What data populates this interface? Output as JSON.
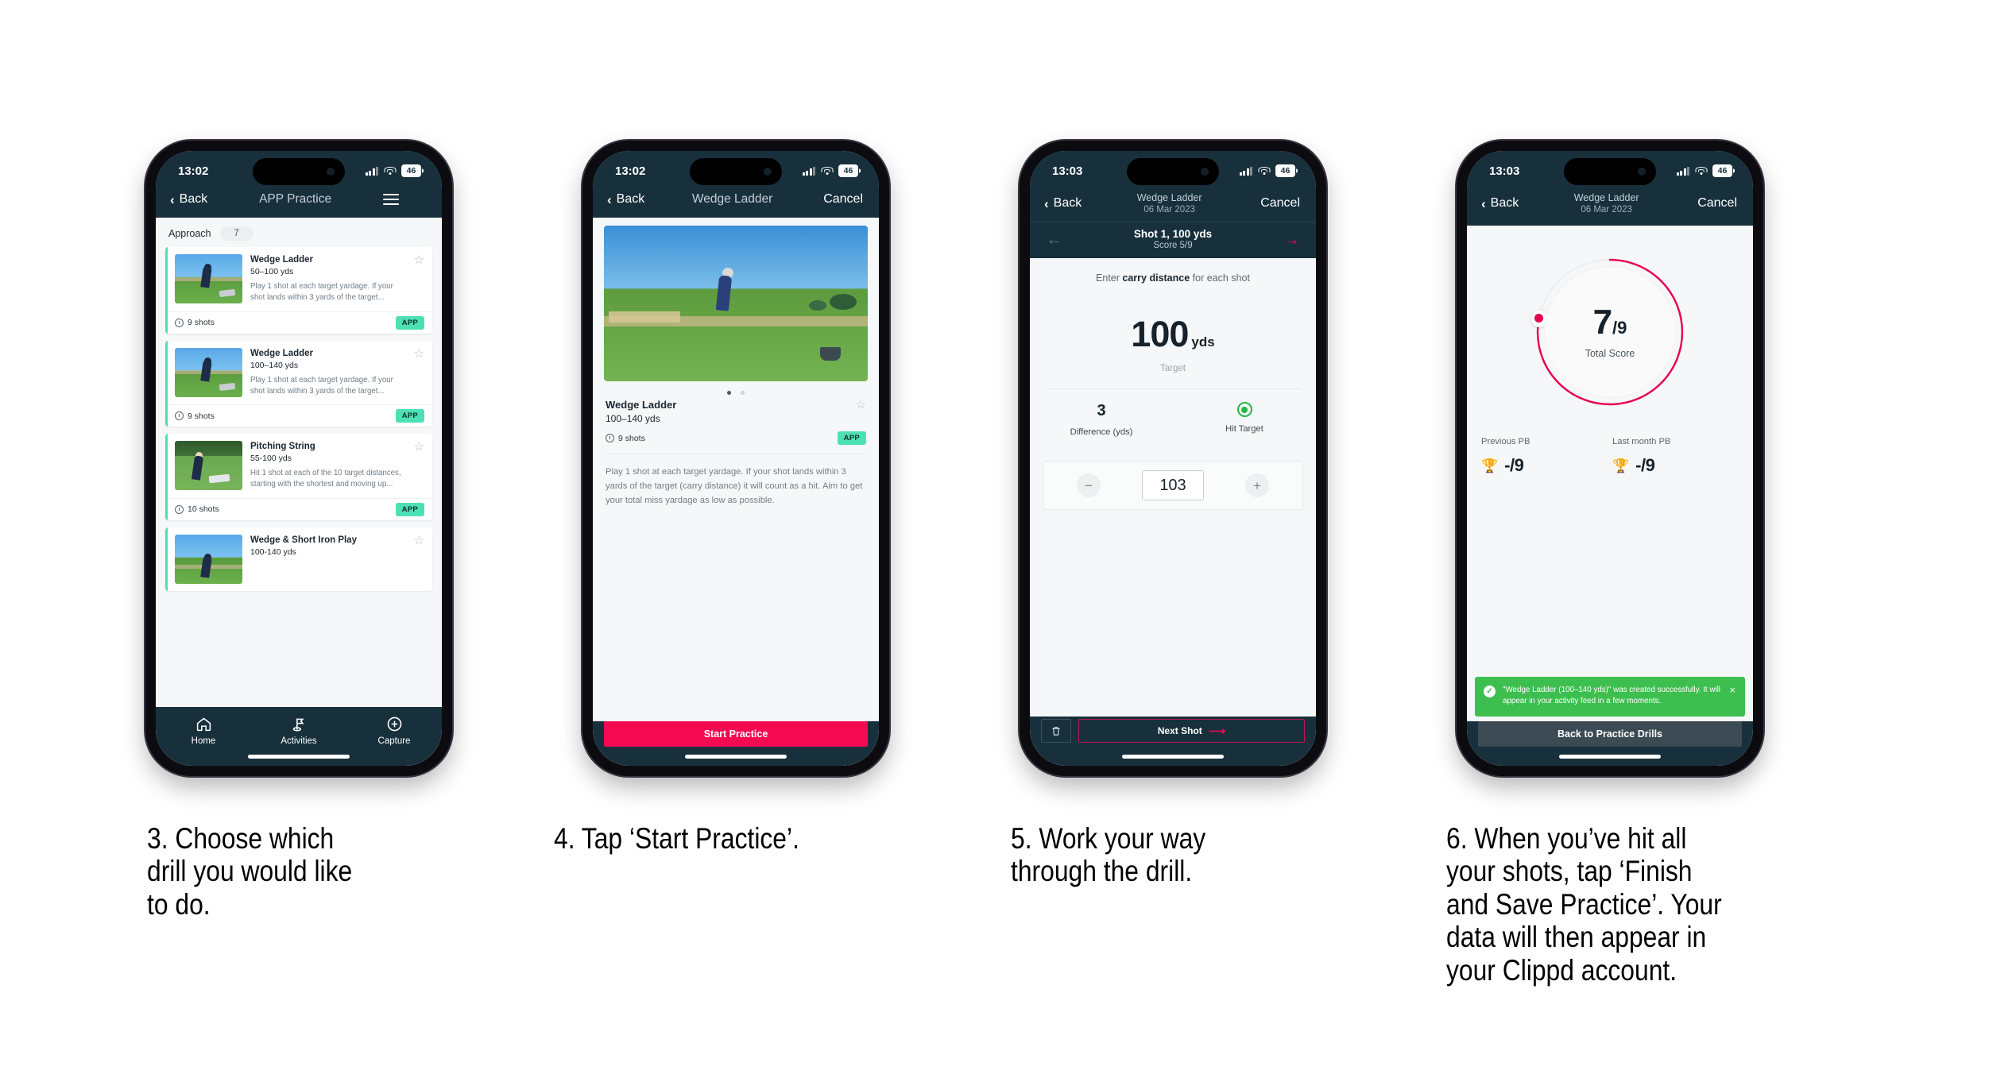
{
  "meta": {
    "accent_pink": "#f50a52",
    "accent_mint": "#4de0b5",
    "navy": "#17303c",
    "toast_green": "#3dbf4f"
  },
  "phones": [
    {
      "id": "phone-1",
      "status": {
        "time": "13:02",
        "battery": "46"
      },
      "nav": {
        "back": "Back",
        "title": "APP Practice",
        "title_sub": "",
        "right": ""
      },
      "filter": {
        "label": "Approach",
        "count": "7"
      },
      "cards": [
        {
          "title": "Wedge Ladder",
          "subtitle": "50–100 yds",
          "description": "Play 1 shot at each target yardage. If your shot lands within 3 yards of the target...",
          "shots": "9 shots",
          "badge": "APP"
        },
        {
          "title": "Wedge Ladder",
          "subtitle": "100–140 yds",
          "description": "Play 1 shot at each target yardage. If your shot lands within 3 yards of the target...",
          "shots": "9 shots",
          "badge": "APP"
        },
        {
          "title": "Pitching String",
          "subtitle": "55-100 yds",
          "description": "Hit 1 shot at each of the 10 target distances, starting with the shortest and moving up...",
          "shots": "10 shots",
          "badge": "APP"
        },
        {
          "title": "Wedge & Short Iron Play",
          "subtitle": "100-140 yds",
          "description": "",
          "shots": "",
          "badge": ""
        }
      ],
      "tabs": [
        {
          "label": "Home",
          "icon": "home-icon"
        },
        {
          "label": "Activities",
          "icon": "flag-icon"
        },
        {
          "label": "Capture",
          "icon": "plus-circle-icon"
        }
      ]
    },
    {
      "id": "phone-2",
      "status": {
        "time": "13:02",
        "battery": "46"
      },
      "nav": {
        "back": "Back",
        "title": "Wedge Ladder",
        "title_sub": "",
        "right": "Cancel"
      },
      "detail": {
        "title": "Wedge Ladder",
        "subtitle": "100–140 yds",
        "shots": "9 shots",
        "badge": "APP",
        "description": "Play 1 shot at each target yardage. If your shot lands within 3 yards of the target (carry distance) it will count as a hit. Aim to get your total miss yardage as low as possible."
      },
      "cta": "Start Practice"
    },
    {
      "id": "phone-3",
      "status": {
        "time": "13:03",
        "battery": "46"
      },
      "nav": {
        "back": "Back",
        "title": "Wedge Ladder",
        "title_sub": "06 Mar 2023",
        "right": "Cancel"
      },
      "shotnav": {
        "title": "Shot 1, 100 yds",
        "subtitle": "Score 5/9"
      },
      "prompt_pre": "Enter ",
      "prompt_bold": "carry distance",
      "prompt_post": " for each shot",
      "target": {
        "value": "100",
        "unit": "yds",
        "label": "Target"
      },
      "stats": [
        {
          "value": "3",
          "label": "Difference (yds)"
        },
        {
          "value": "",
          "label": "Hit Target",
          "icon": "target-ring-icon"
        }
      ],
      "stepper": {
        "minus": "−",
        "value": "103",
        "plus": "+"
      },
      "footer": {
        "delete_icon": "trash-icon",
        "next": "Next Shot"
      }
    },
    {
      "id": "phone-4",
      "status": {
        "time": "13:03",
        "battery": "46"
      },
      "nav": {
        "back": "Back",
        "title": "Wedge Ladder",
        "title_sub": "06 Mar 2023",
        "right": "Cancel"
      },
      "gauge": {
        "score": "7",
        "divider": "/",
        "total": "9",
        "label": "Total Score",
        "percent": 78
      },
      "pbs": [
        {
          "label": "Previous PB",
          "value": "-/9",
          "icon": "trophy-icon"
        },
        {
          "label": "Last month PB",
          "value": "-/9",
          "icon": "trophy-icon"
        }
      ],
      "toast": {
        "message": "\"Wedge Ladder (100–140 yds)\" was created successfully. It will appear in your activity feed in a few moments.",
        "close": "×"
      },
      "cta": "Back to Practice Drills"
    }
  ],
  "captions": [
    "3. Choose which\ndrill you would like\nto do.",
    "4. Tap ‘Start Practice’.",
    "5. Work your way\nthrough the drill.",
    "6. When you’ve hit all\nyour shots, tap ‘Finish\nand Save Practice’. Your\ndata will then appear in\nyour Clippd account."
  ]
}
